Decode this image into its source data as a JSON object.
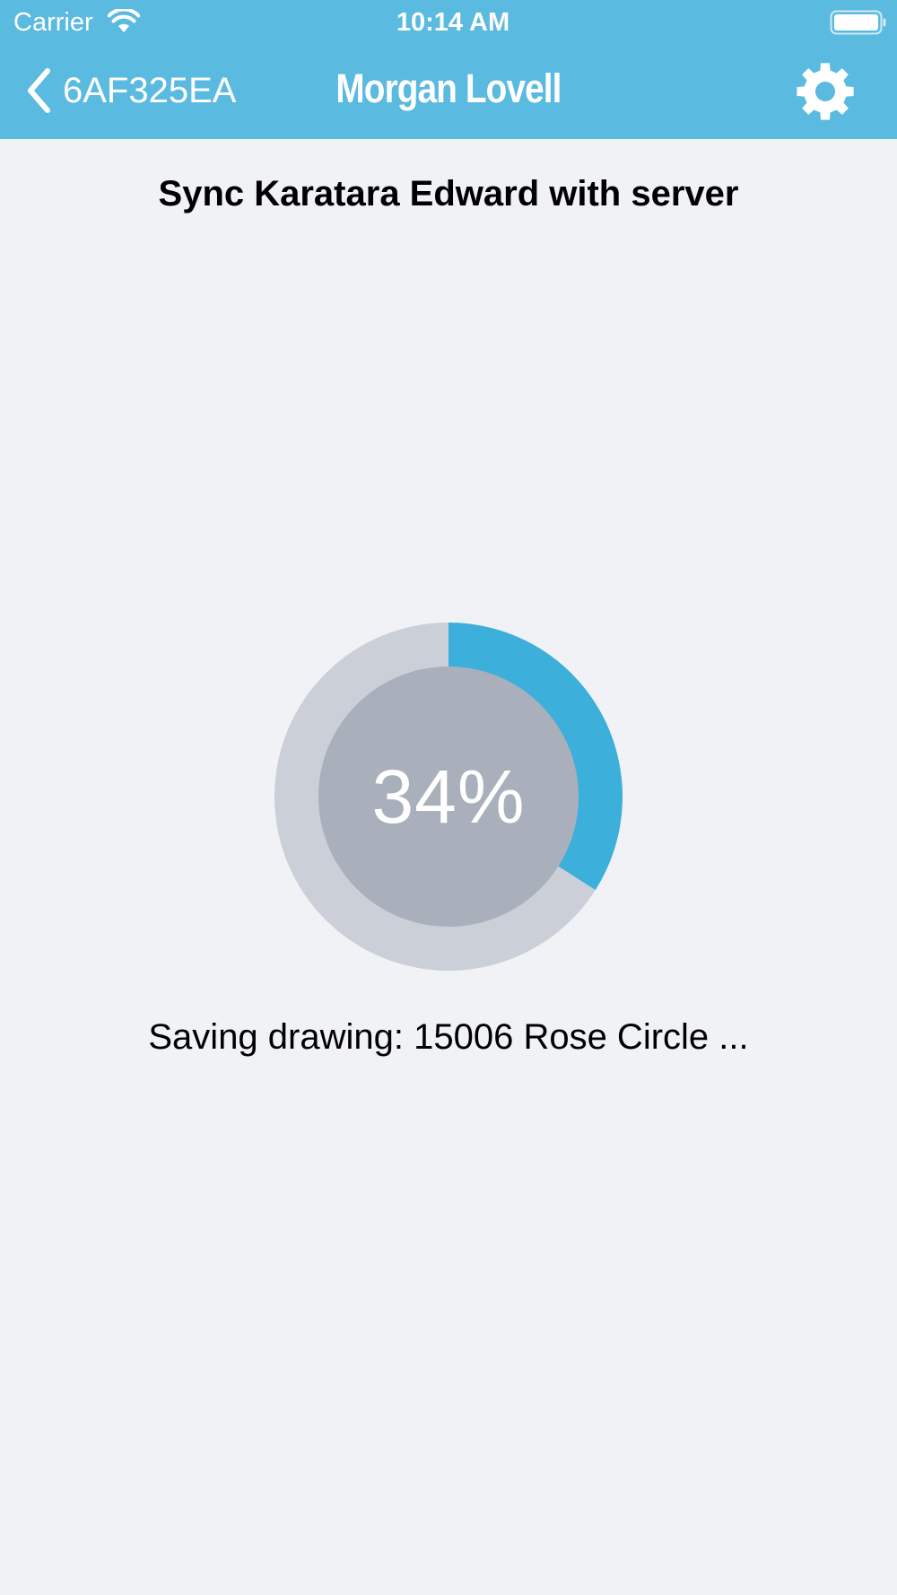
{
  "status_bar": {
    "carrier": "Carrier",
    "time": "10:14 AM",
    "wifi_icon": "wifi-icon",
    "battery_icon": "battery-full-icon"
  },
  "nav": {
    "back_label": "6AF325EA",
    "back_icon": "chevron-left-icon",
    "brand": "Morgan Lovell",
    "settings_icon": "gear-icon"
  },
  "sync": {
    "title": "Sync Karatara Edward with server",
    "progress_percent": 34,
    "progress_label": "34%",
    "message": "Saving drawing: 15006 Rose Circle ..."
  },
  "colors": {
    "header_bg": "#5bbae0",
    "page_bg": "#f0f2f6",
    "progress_fill": "#3cafdb",
    "progress_track": "#cbcfd8",
    "progress_center": "#a9b0bc"
  }
}
